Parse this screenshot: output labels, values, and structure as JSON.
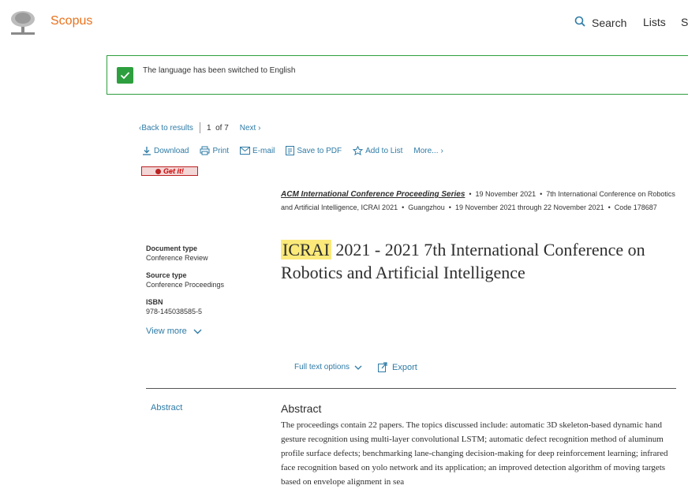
{
  "header": {
    "brand": "Scopus",
    "nav": {
      "search": "Search",
      "lists": "Lists",
      "s_cut": "S"
    }
  },
  "notification": {
    "message": "The language has been switched to English"
  },
  "result_nav": {
    "back": "Back to results",
    "position": "1",
    "of": "of",
    "total": "7",
    "next": "Next"
  },
  "toolbar": {
    "download": "Download",
    "print": "Print",
    "email": "E-mail",
    "save_pdf": "Save to PDF",
    "add_list": "Add to List",
    "more": "More..."
  },
  "getit": {
    "label": "Get it!"
  },
  "source": {
    "series": "ACM International Conference Proceeding Series",
    "date": "19 November 2021",
    "conference": "7th International Conference on Robotics and Artificial Intelligence, ICRAI 2021",
    "city": "Guangzhou",
    "dates_range": "19 November 2021 through 22 November 2021",
    "code": "Code 178687"
  },
  "meta": {
    "document_type_label": "Document type",
    "document_type": "Conference Review",
    "source_type_label": "Source type",
    "source_type": "Conference Proceedings",
    "isbn_label": "ISBN",
    "isbn": "978-145038585-5",
    "view_more": "View more"
  },
  "title": {
    "highlight": "ICRAI",
    "rest": "2021 - 2021 7th International Conference on Robotics and Artificial Intelligence"
  },
  "actions": {
    "full_text": "Full text options",
    "export": "Export"
  },
  "abstract": {
    "side_link": "Abstract",
    "heading": "Abstract",
    "text": "The proceedings contain 22 papers. The topics discussed include: automatic 3D skeleton-based dynamic hand gesture recognition using multi-layer convolutional LSTM; automatic defect recognition method of aluminum profile surface defects; benchmarking lane-changing decision-making for deep reinforcement learning; infrared face recognition based on yolo network and its application; an improved detection algorithm of moving targets based on envelope alignment in sea"
  },
  "colors": {
    "brand": "#e9711c",
    "link": "#2e7ba6",
    "success": "#2e9f3e",
    "highlight": "#fbe97a"
  }
}
